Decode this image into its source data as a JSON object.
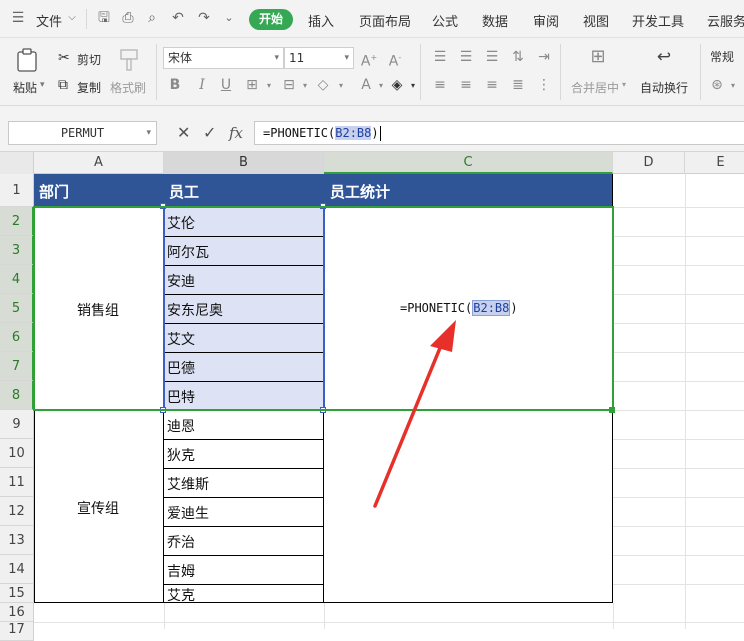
{
  "menu": {
    "file_label": "文件",
    "tabs": [
      "开始",
      "插入",
      "页面布局",
      "公式",
      "数据",
      "审阅",
      "视图",
      "开发工具",
      "云服务"
    ]
  },
  "ribbon": {
    "paste": "粘贴",
    "cut": "剪切",
    "copy": "复制",
    "format_painter": "格式刷",
    "font_name": "宋体",
    "font_size": "11",
    "merge_center": "合并居中",
    "wrap_text": "自动换行",
    "number_format": "常规"
  },
  "formula_bar": {
    "name_box": "PERMUT",
    "fx_label": "fx",
    "formula_prefix": "=PHONETIC(",
    "formula_ref": "B2:B8",
    "formula_suffix": ")"
  },
  "grid": {
    "columns": [
      "A",
      "B",
      "C",
      "D",
      "E"
    ],
    "rows": [
      "1",
      "2",
      "3",
      "4",
      "5",
      "6",
      "7",
      "8",
      "9",
      "10",
      "11",
      "12",
      "13",
      "14",
      "15",
      "16",
      "17"
    ],
    "header": {
      "a": "部门",
      "b": "员工",
      "c": "员工统计"
    },
    "dept_sales": "销售组",
    "dept_promo": "宣传组",
    "employees": [
      "艾伦",
      "阿尔瓦",
      "安迪",
      "安东尼奥",
      "艾文",
      "巴德",
      "巴特",
      "迪恩",
      "狄克",
      "艾维斯",
      "爱迪生",
      "乔治",
      "吉姆",
      "艾克"
    ],
    "c_formula_prefix": "=PHONETIC(",
    "c_formula_ref": "B2:B8",
    "c_formula_suffix": ")"
  },
  "colors": {
    "accent_green": "#34a853",
    "header_fill": "#2f5597",
    "selection_fill": "#dde3f4",
    "arrow_red": "#e8302a"
  }
}
